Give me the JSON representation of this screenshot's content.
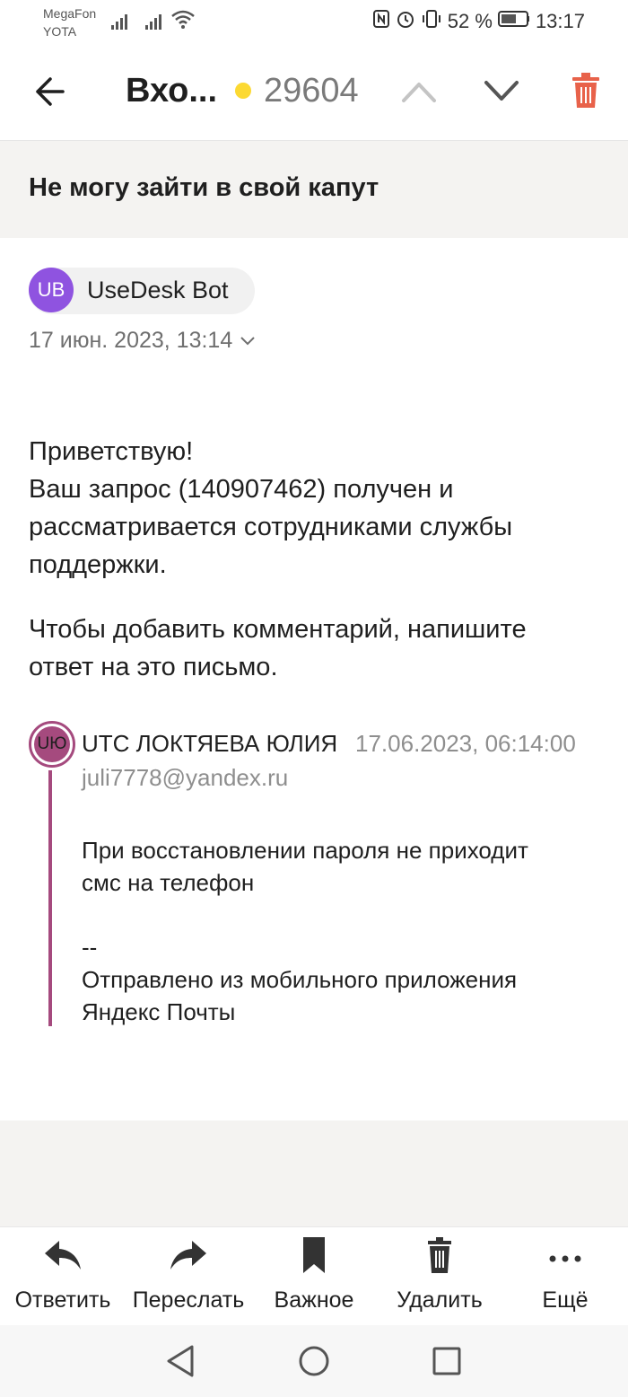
{
  "status_bar": {
    "carrier1": "MegaFon",
    "carrier2": "YOTA",
    "battery": "52 %",
    "time": "13:17"
  },
  "header": {
    "folder": "Вхо...",
    "unread_count": "29604",
    "dot_color": "#fcd932",
    "delete_color": "#e8624a"
  },
  "message": {
    "subject": "Не могу зайти в свой капут",
    "sender_initials": "UB",
    "sender_name": "UseDesk Bot",
    "date": "17 июн. 2023, 13:14",
    "body": [
      "Приветствую!",
      "Ваш запрос (140907462) получен и",
      "рассматривается сотрудниками службы",
      "поддержки.",
      "Чтобы добавить комментарий, напишите",
      "ответ на это письмо."
    ]
  },
  "quote": {
    "initials": "UЮ",
    "name": "UTC ЛОКТЯЕВА ЮЛИЯ",
    "date": "17.06.2023, 06:14:00",
    "email": "juli7778@yandex.ru",
    "lines": [
      "При  восстановлении пароля не приходит",
      "смс на телефон",
      "--",
      "Отправлено из мобильного приложения",
      "Яндекс Почты"
    ]
  },
  "toolbar": {
    "reply": "Ответить",
    "forward": "Переслать",
    "important": "Важное",
    "delete": "Удалить",
    "more": "Ещё"
  }
}
